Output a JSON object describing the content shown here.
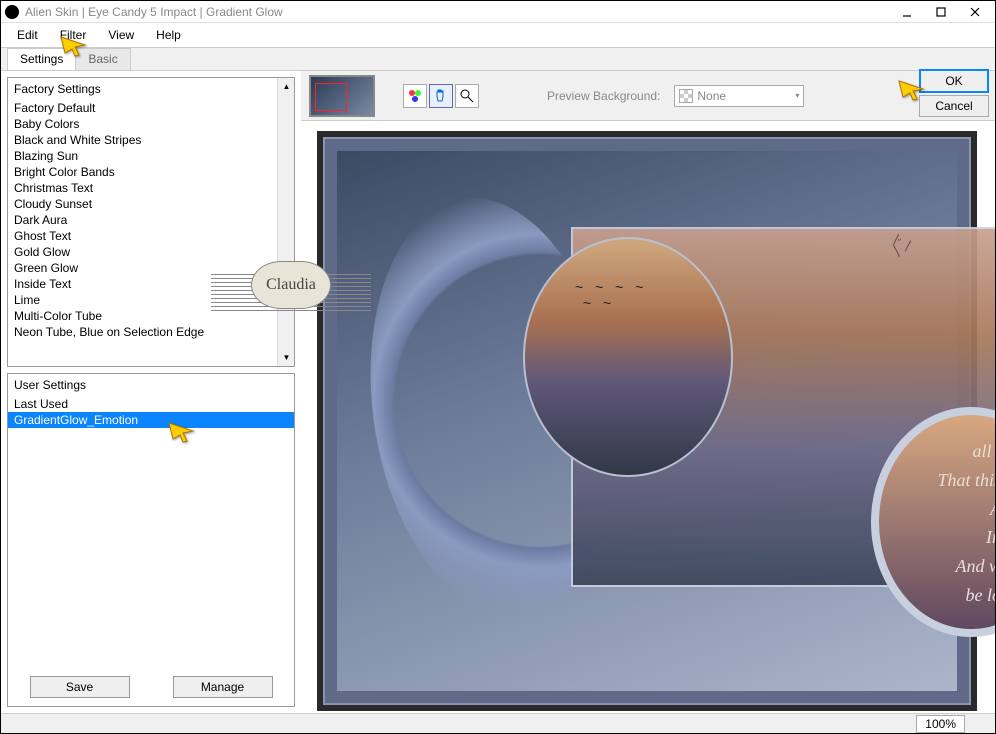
{
  "window": {
    "title": "Alien Skin | Eye Candy 5 Impact | Gradient Glow"
  },
  "menu": {
    "edit": "Edit",
    "filter": "Filter",
    "view": "View",
    "help": "Help"
  },
  "tabs": {
    "settings": "Settings",
    "basic": "Basic"
  },
  "factory": {
    "header": "Factory Settings",
    "items": [
      "Factory Default",
      "Baby Colors",
      "Black and White Stripes",
      "Blazing Sun",
      "Bright Color Bands",
      "Christmas Text",
      "Cloudy Sunset",
      "Dark Aura",
      "Ghost Text",
      "Gold Glow",
      "Green Glow",
      "Inside Text",
      "Lime",
      "Multi-Color Tube",
      "Neon Tube, Blue on Selection Edge"
    ]
  },
  "user": {
    "header": "User Settings",
    "items": [
      "Last Used",
      "GradientGlow_Emotion"
    ],
    "selected_index": 1
  },
  "buttons": {
    "save": "Save",
    "manage": "Manage",
    "ok": "OK",
    "cancel": "Cancel"
  },
  "preview": {
    "bg_label": "Preview Background:",
    "bg_value": "None"
  },
  "status": {
    "zoom": "100%"
  },
  "stamp": {
    "text": "Claudia"
  },
  "script_lines": [
    "all t",
    "That this",
    "A",
    "In",
    "And w",
    "be lo"
  ]
}
